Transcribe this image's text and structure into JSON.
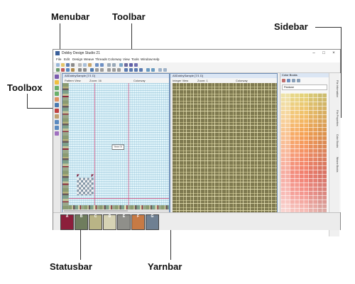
{
  "callouts": {
    "menubar": "Menubar",
    "toolbar": "Toolbar",
    "sidebar": "Sidebar",
    "toolbox": "Toolbox",
    "statusbar": "Statusbar",
    "yarnbar": "Yarnbar"
  },
  "window": {
    "title": "Dobby Design Studio 21"
  },
  "menu": [
    "File",
    "Edit",
    "Design",
    "Weave",
    "Threads",
    "Colorway",
    "View",
    "Tools",
    "Window",
    "Help"
  ],
  "panels": {
    "left": {
      "title": "A5DobbySample [7/1 D]",
      "view": "Pattern View",
      "zoom": "Zoom: 16",
      "colorway": "Colorway",
      "tooltip": "Weave 36"
    },
    "right": {
      "title": "A5DobbySample [7/1 D]",
      "view": "Integer View",
      "zoom": "Zoom: 1",
      "colorway": "Colorway"
    }
  },
  "sidebar": {
    "title": "Color Books",
    "search_label": "Pantone",
    "tabs": [
      "File Information",
      "File Properties",
      "Color Books",
      "Weave Books"
    ]
  },
  "yarns": [
    {
      "letter": "A",
      "color": "#8c1f3b"
    },
    {
      "letter": "B",
      "color": "#6f7d5d"
    },
    {
      "letter": "C",
      "color": "#b9b486"
    },
    {
      "letter": "D",
      "color": "#d6d2b4"
    },
    {
      "letter": "E",
      "color": "#8f8f8a"
    },
    {
      "letter": "F",
      "color": "#c77a45"
    },
    {
      "letter": "G",
      "color": "#6f8092"
    }
  ],
  "colors": {
    "accent": "#d44a7a",
    "panel_border": "#6f8fb8"
  }
}
